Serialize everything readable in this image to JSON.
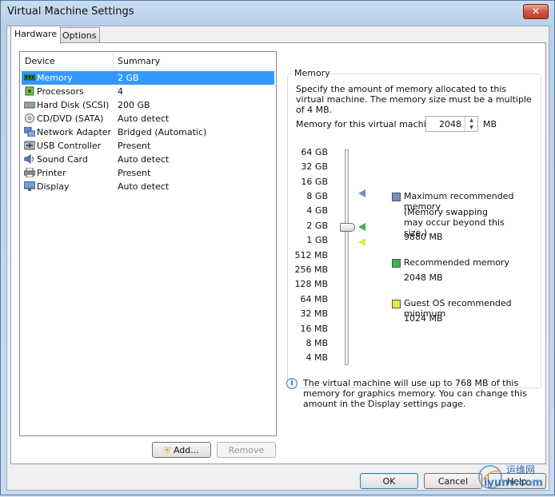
{
  "window": {
    "title": "Virtual Machine Settings"
  },
  "tabs": [
    {
      "label": "Hardware"
    },
    {
      "label": "Options"
    }
  ],
  "device_list": {
    "col_device": "Device",
    "col_summary": "Summary",
    "rows": [
      {
        "name": "Memory",
        "summary": "2 GB",
        "icon": "memory-icon"
      },
      {
        "name": "Processors",
        "summary": "4",
        "icon": "processor-icon"
      },
      {
        "name": "Hard Disk (SCSI)",
        "summary": "200 GB",
        "icon": "hard-disk-icon"
      },
      {
        "name": "CD/DVD (SATA)",
        "summary": "Auto detect",
        "icon": "cd-dvd-icon"
      },
      {
        "name": "Network Adapter",
        "summary": "Bridged (Automatic)",
        "icon": "network-adapter-icon"
      },
      {
        "name": "USB Controller",
        "summary": "Present",
        "icon": "usb-icon"
      },
      {
        "name": "Sound Card",
        "summary": "Auto detect",
        "icon": "sound-icon"
      },
      {
        "name": "Printer",
        "summary": "Present",
        "icon": "printer-icon"
      },
      {
        "name": "Display",
        "summary": "Auto detect",
        "icon": "display-icon"
      }
    ],
    "add_label": "Add...",
    "remove_label": "Remove"
  },
  "memory": {
    "group_title": "Memory",
    "description": "Specify the amount of memory allocated to this virtual machine. The memory size must be a multiple of 4 MB.",
    "field_label": "Memory for this virtual machine:",
    "value": "2048",
    "unit": "MB",
    "scale": [
      "64 GB",
      "32 GB",
      "16 GB",
      "8 GB",
      "4 GB",
      "2 GB",
      "1 GB",
      "512 MB",
      "256 MB",
      "128 MB",
      "64 MB",
      "32 MB",
      "16 MB",
      "8 MB",
      "4 MB"
    ],
    "slider_value_mb": 2048,
    "legend": {
      "max_label": "Maximum recommended memory",
      "max_note": "(Memory swapping may occur beyond this size.)",
      "max_value": "9880 MB",
      "rec_label": "Recommended memory",
      "rec_value": "2048 MB",
      "min_label": "Guest OS recommended minimum",
      "min_value": "1024 MB"
    },
    "colors": {
      "max": "#6f8fbf",
      "rec": "#3cb44a",
      "min": "#e6e64a"
    }
  },
  "info_text": "The virtual machine will use up to 768 MB of this memory for graphics memory. You can change this amount in the Display settings page.",
  "buttons": {
    "ok": "OK",
    "cancel": "Cancel",
    "help": "Help"
  },
  "watermark": {
    "line1": "运维网",
    "line2": "iyunv.com"
  }
}
